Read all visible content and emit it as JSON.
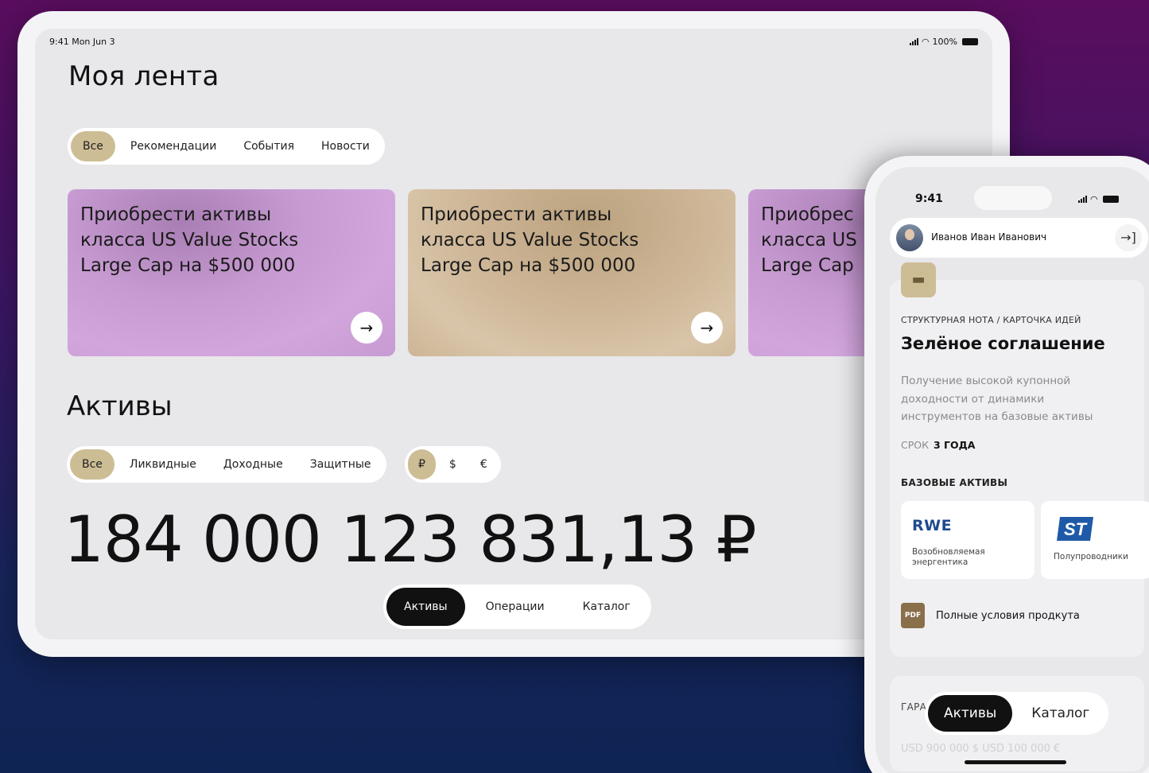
{
  "tablet": {
    "status": {
      "time": "9:41",
      "date": "Mon Jun 3",
      "battery": "100%"
    },
    "feed_title": "Моя лента",
    "feed_tabs": [
      "Все",
      "Рекомендации",
      "События",
      "Новости"
    ],
    "cards": [
      {
        "line1": "Приобрести активы",
        "line2": "класса US Value Stocks",
        "line3": "Large Cap на $500 000",
        "arrow": "→"
      },
      {
        "line1": "Приобрести активы",
        "line2": "класса US Value Stocks",
        "line3": "Large Cap на $500 000",
        "arrow": "→"
      },
      {
        "line1": "Приобрес",
        "line2": "класса US",
        "line3": "Large Cap"
      }
    ],
    "assets_title": "Активы",
    "asset_tabs": [
      "Все",
      "Ликвидные",
      "Доходные",
      "Защитные"
    ],
    "currency_tabs": [
      "₽",
      "$",
      "€"
    ],
    "total": "184 000 123 831,13 ₽",
    "bottom_nav": [
      "Активы",
      "Операции",
      "Каталог"
    ]
  },
  "phone": {
    "status": {
      "time": "9:41"
    },
    "user_name": "Иванов Иван Иванович",
    "logout_icon": "→]",
    "caption": "СТРУКТУРНАЯ НОТА / КАРТОЧКА ИДЕЙ",
    "title": "Зелёное соглашение",
    "description": "Получение высокой купонной доходности от динамики инструментов на базовые активы",
    "term_label": "СРОК",
    "term_value": "3 ГОДА",
    "base_assets_title": "БАЗОВЫЕ АКТИВЫ",
    "base_assets": [
      {
        "logo": "RWE",
        "label": "Возобновляемая энергентика"
      },
      {
        "logo": "ST",
        "label": "Полупроводники"
      }
    ],
    "pdf_icon": "PDF",
    "pdf_link": "Полные условия продкута",
    "card2_caption": "ГАРА",
    "card2_faint": "USD 900 000 $ USD 100 000 €",
    "bottom_nav": [
      "Активы",
      "Каталог"
    ]
  },
  "colors": {
    "accent_gold": "#cdbd95",
    "card_purple": "#c79bd2",
    "card_gold": "#cdb596",
    "nav_active": "#111111",
    "rwe_blue": "#1f4a8f",
    "st_blue": "#1e5aa8"
  }
}
